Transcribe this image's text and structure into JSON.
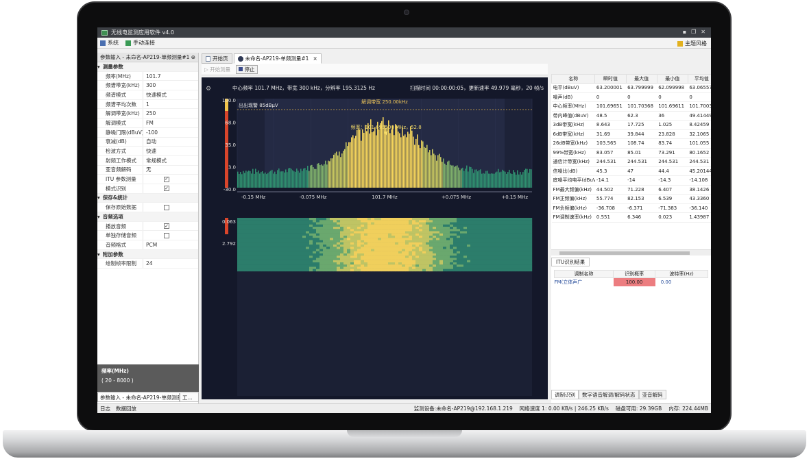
{
  "window": {
    "title": "无线电监测应用软件 v4.0"
  },
  "menu": {
    "system": "系统",
    "manual_connect": "手动连接",
    "theme": "主题风格"
  },
  "left_panel": {
    "header": "参数输入 - 未命名-AP219-单频测量#1",
    "pin": "⊕",
    "sections": [
      {
        "title": "测量参数",
        "rows": [
          {
            "k": "频率(MHz)",
            "v": "101.7"
          },
          {
            "k": "频谱带宽(kHz)",
            "v": "300"
          },
          {
            "k": "频谱模式",
            "v": "快速模式"
          },
          {
            "k": "频谱平均次数",
            "v": "1"
          },
          {
            "k": "解调带宽(kHz)",
            "v": "250"
          },
          {
            "k": "解调模式",
            "v": "FM"
          },
          {
            "k": "静噪门限(dBuV)",
            "v": "-100"
          },
          {
            "k": "衰减(dB)",
            "v": "自动"
          },
          {
            "k": "检波方式",
            "v": "快速"
          },
          {
            "k": "射频工作模式",
            "v": "常规模式"
          },
          {
            "k": "亚音频解码",
            "v": "无"
          },
          {
            "k": "ITU 参数测量",
            "check": true
          },
          {
            "k": "模式识别",
            "check": true
          }
        ]
      },
      {
        "title": "保存&统计",
        "rows": [
          {
            "k": "保存原始数据",
            "check": false
          }
        ]
      },
      {
        "title": "音频选项",
        "rows": [
          {
            "k": "播放音频",
            "check": true
          },
          {
            "k": "单独存储音频",
            "check": false
          },
          {
            "k": "音频格式",
            "v": "PCM"
          }
        ]
      },
      {
        "title": "附加参数",
        "rows": [
          {
            "k": "绘制帧率限制",
            "v": "24"
          }
        ]
      }
    ],
    "freq_box": {
      "title": "频率(MHz)",
      "range": "( 20 - 8000 )"
    },
    "tabs": [
      "参数输入 - 未命名-AP219-单频测量...",
      "工..."
    ]
  },
  "center": {
    "tabs": [
      "开始页",
      "未命名-AP219-单频测量#1"
    ],
    "tab_close": "×",
    "toolbar": {
      "start": "开始测量",
      "stop": "停止"
    },
    "info_left": "中心频率 101.7 MHz，带宽 300 kHz，分辨率 195.3125 Hz",
    "info_right": "扫描时间 00:00:00:05，更新速率 49.979 毫秒，20 帧/s",
    "spectrum": {
      "yticks": [
        "100.0",
        "68.0",
        "35.0",
        "3.0",
        "-30.0"
      ],
      "alarm": "出出现警 85dBμV",
      "demod_bw": "解调带宽 250.00kHz",
      "marker": "频率：101.695508 MHz，52.8",
      "xticks": [
        "-0.15 MHz",
        "-0.075 MHz",
        "101.7 MHz",
        "+0.075 MHz",
        "+0.15 MHz"
      ]
    },
    "waterfall": {
      "ylabels": [
        "+0.063",
        "+2.792"
      ]
    }
  },
  "right_panel": {
    "columns": [
      "名称",
      "瞬时值",
      "最大值",
      "最小值",
      "平均值"
    ],
    "rows": [
      [
        "电平(dBuV)",
        "63.200001",
        "63.799999",
        "62.099998",
        "63.06557"
      ],
      [
        "噪声(dB)",
        "0",
        "0",
        "0",
        "0"
      ],
      [
        "中心频率(MHz)",
        "101.69651",
        "101.70368",
        "101.69611",
        "101.7003"
      ],
      [
        "带内峰值(dBuV)",
        "48.5",
        "62.3",
        "36",
        "49.41449"
      ],
      [
        "3dB带宽(kHz)",
        "8.643",
        "17.725",
        "1.025",
        "8.42459"
      ],
      [
        "6dB带宽(kHz)",
        "31.69",
        "39.844",
        "23.828",
        "32.1065"
      ],
      [
        "26dB带宽(kHz)",
        "103.565",
        "108.74",
        "83.74",
        "101.055"
      ],
      [
        "99%带宽(kHz)",
        "83.057",
        "85.01",
        "73.291",
        "80.1652"
      ],
      [
        "通信计带宽(kHz)",
        "244.531",
        "244.531",
        "244.531",
        "244.531"
      ],
      [
        "信噪比(dB)",
        "45.3",
        "47",
        "44.4",
        "45.20144"
      ],
      [
        "底噪平均电平(dBuV)",
        "-14.1",
        "-14",
        "-14.3",
        "-14.108"
      ],
      [
        "FM最大频偏(kHz)",
        "44.502",
        "71.228",
        "6.407",
        "38.1426"
      ],
      [
        "FM正频偏(kHz)",
        "55.774",
        "82.153",
        "6.539",
        "43.3360"
      ],
      [
        "FM负频偏(kHz)",
        "-36.708",
        "-6.371",
        "-71.383",
        "-36.140"
      ],
      [
        "FM调制速率(kHz)",
        "0.551",
        "6.346",
        "0.023",
        "1.43987"
      ]
    ],
    "itu_tab": "ITU识别结果",
    "itu_columns": [
      "调制名称",
      "识别概率",
      "波特率(Hz)"
    ],
    "itu_row": {
      "name": "FM(立体声广",
      "prob": "100.00",
      "baud": "0.00"
    },
    "bottom_tabs": [
      "调制识别",
      "数字语音解调/解码状态",
      "亚音解码"
    ]
  },
  "statusbar": {
    "log": "日志",
    "playback": "数据回放",
    "device": "监测设备:未命名-AP219@192.168.1.219",
    "net": "网络速度 1: 0.00 KB/s  |  246.25 KB/s",
    "disk": "磁盘可用: 29.39GB",
    "mem": "内存: 224.44MB"
  },
  "colors": {
    "viz_bg": "#14182a",
    "spectrum_noise": "#2f8f6f",
    "spectrum_peak": "#f3d35b",
    "alarm_line": "#e0b24a",
    "prob_bar": "#ec7d80"
  }
}
